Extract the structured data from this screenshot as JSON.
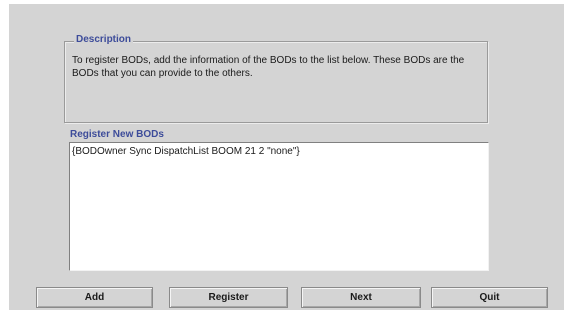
{
  "description": {
    "legend": "Description",
    "text": "To register BODs, add the information of the BODs to the list below. These BODs are the BODs that you can provide to the others."
  },
  "register_list": {
    "label": "Register New BODs",
    "items": [
      "{BODOwner Sync DispatchList BOOM 21 2 \"none\"}"
    ]
  },
  "buttons": {
    "add": "Add",
    "register": "Register",
    "next": "Next",
    "quit": "Quit"
  }
}
